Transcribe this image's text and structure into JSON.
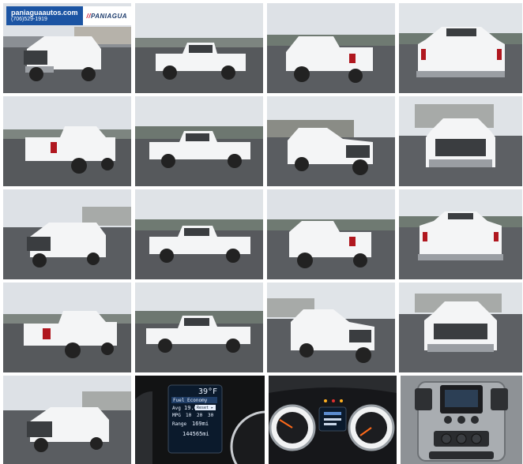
{
  "dealer": {
    "website": "paniaguaautos.com",
    "phone": "(706)529-1919",
    "brand_logo": "PANIAGUA"
  },
  "cluster": {
    "temperature": "39°F",
    "menu_title": "Fuel Economy",
    "avg_label": "Avg",
    "avg_value": "19.6",
    "reset_label": "Reset ▸",
    "mpg_label": "MPG",
    "range_label": "Range",
    "range_value": "169mi",
    "odometer": "144565mi",
    "gauge_scale": [
      "10",
      "20",
      "30"
    ]
  },
  "colors": {
    "sky": "#d9dde2",
    "asphalt": "#55585c",
    "truck_white": "#f4f5f6",
    "logo_blue": "#1b54a3"
  },
  "photos": [
    {
      "view": "front-three-quarter-left"
    },
    {
      "view": "side-left"
    },
    {
      "view": "rear-three-quarter-left"
    },
    {
      "view": "rear"
    },
    {
      "view": "rear-three-quarter-left"
    },
    {
      "view": "side-left"
    },
    {
      "view": "front-three-quarter-left"
    },
    {
      "view": "front"
    },
    {
      "view": "front-three-quarter-left"
    },
    {
      "view": "side-left"
    },
    {
      "view": "rear-three-quarter-left"
    },
    {
      "view": "rear"
    },
    {
      "view": "rear-three-quarter-left"
    },
    {
      "view": "side-left"
    },
    {
      "view": "front-three-quarter-right"
    },
    {
      "view": "front"
    },
    {
      "view": "front-three-quarter-left"
    },
    {
      "view": "instrument-cluster-display"
    },
    {
      "view": "instrument-cluster-gauges"
    },
    {
      "view": "center-console"
    }
  ]
}
